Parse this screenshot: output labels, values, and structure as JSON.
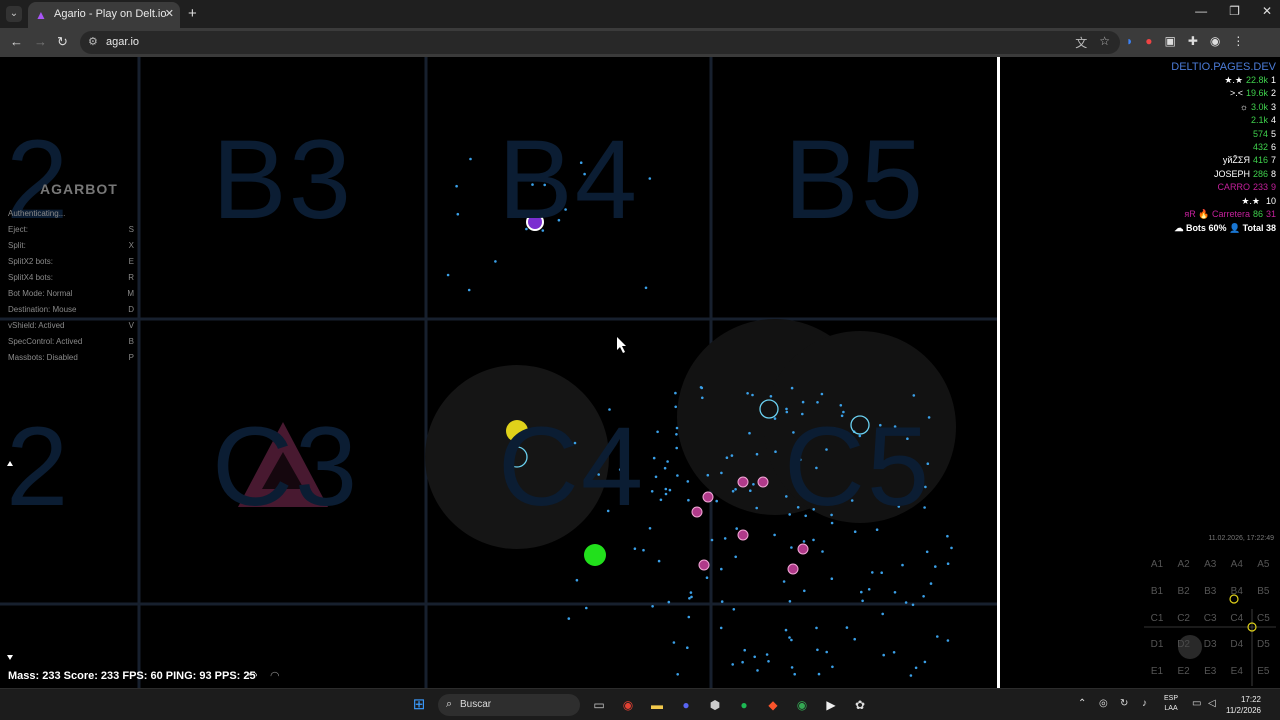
{
  "browser": {
    "tab_title": "Agario - Play on Delt.io",
    "url": "agar.io",
    "new_tab_icon": "+",
    "close_icon": "✕",
    "window_controls": [
      "—",
      "❐",
      "✕"
    ]
  },
  "game": {
    "sectors": [
      {
        "label": "2"
      },
      {
        "label": "B3"
      },
      {
        "label": "B4"
      },
      {
        "label": "B5"
      },
      {
        "label": "2"
      },
      {
        "label": "C3"
      },
      {
        "label": "C4"
      },
      {
        "label": "C5"
      }
    ],
    "logo_text": "AGARBOT",
    "menu": {
      "auth": "Authenticating...",
      "items": [
        {
          "label": "Eject:",
          "key": "S"
        },
        {
          "label": "Split:",
          "key": "X"
        },
        {
          "label": "SplitX2 bots:",
          "key": "E"
        },
        {
          "label": "SplitX4 bots:",
          "key": "R"
        },
        {
          "label": "Bot Mode: Normal",
          "key": "M"
        },
        {
          "label": "Destination: Mouse",
          "key": "D"
        },
        {
          "label": "vShield: Actived",
          "key": "V"
        },
        {
          "label": "SpecControl: Actived",
          "key": "B"
        },
        {
          "label": "Massbots: Disabled",
          "key": "P"
        }
      ]
    },
    "leaderboard": {
      "title": "DELTIO.PAGES.DEV",
      "rows": [
        {
          "name": "★.★",
          "score": "22.8k",
          "rank": "1",
          "name_color": "#ffffff",
          "score_color": "#3fd04c",
          "rank_color": "#ffffff"
        },
        {
          "name": ">.<",
          "score": "19.6k",
          "rank": "2",
          "name_color": "#ffffff",
          "score_color": "#3fd04c",
          "rank_color": "#ffffff"
        },
        {
          "name": "☼",
          "score": "3.0k",
          "rank": "3",
          "name_color": "#ffffff",
          "score_color": "#3fd04c",
          "rank_color": "#ffffff"
        },
        {
          "name": "",
          "score": "2.1k",
          "rank": "4",
          "name_color": "#ffffff",
          "score_color": "#3fd04c",
          "rank_color": "#ffffff"
        },
        {
          "name": "",
          "score": "574",
          "rank": "5",
          "name_color": "#ffffff",
          "score_color": "#3fd04c",
          "rank_color": "#ffffff"
        },
        {
          "name": "",
          "score": "432",
          "rank": "6",
          "name_color": "#ffffff",
          "score_color": "#3fd04c",
          "rank_color": "#ffffff"
        },
        {
          "name": "уйŽΣЯ",
          "score": "416",
          "rank": "7",
          "name_color": "#ffffff",
          "score_color": "#3fd04c",
          "rank_color": "#ffffff"
        },
        {
          "name": "JOSEPH",
          "score": "286",
          "rank": "8",
          "name_color": "#ffffff",
          "score_color": "#3fd04c",
          "rank_color": "#ffffff"
        },
        {
          "name": "CARRO",
          "score": "233",
          "rank": "9",
          "name_color": "#c4209b",
          "score_color": "#c4209b",
          "rank_color": "#c4209b"
        },
        {
          "name": "★.★",
          "score": "",
          "rank": "10",
          "name_color": "#ffffff",
          "score_color": "#3fd04c",
          "rank_color": "#ffffff"
        },
        {
          "name": "яR 🔥 Carretera",
          "score": "86",
          "rank": "31",
          "name_color": "#c4209b",
          "score_color": "#3fd04c",
          "rank_color": "#c4209b"
        }
      ],
      "footer": "☁ Bots 60% 👤 Total 38"
    },
    "timestamp": "11.02.2026, 17:22:49",
    "minimap": {
      "cells": [
        "A1",
        "A2",
        "A3",
        "A4",
        "A5",
        "B1",
        "B2",
        "B3",
        "B4",
        "B5",
        "C1",
        "C2",
        "C3",
        "C4",
        "C5",
        "D1",
        "D2",
        "D3",
        "D4",
        "D5",
        "E1",
        "E2",
        "E3",
        "E4",
        "E5"
      ]
    },
    "stats": "Mass: 233 Score: 233 FPS: 60 PING: 93 PPS: 25"
  },
  "taskbar": {
    "search_label": "Buscar",
    "lang_top": "ESP",
    "lang_bottom": "LAA",
    "time": "17:22",
    "date": "11/2/2026"
  },
  "colors": {
    "cell_yellow": "#e0d21a",
    "cell_green": "#22e01c",
    "virus_cyan": "#6ad0f0",
    "pellet": "#3aa0e8",
    "grid": "#17202e"
  }
}
